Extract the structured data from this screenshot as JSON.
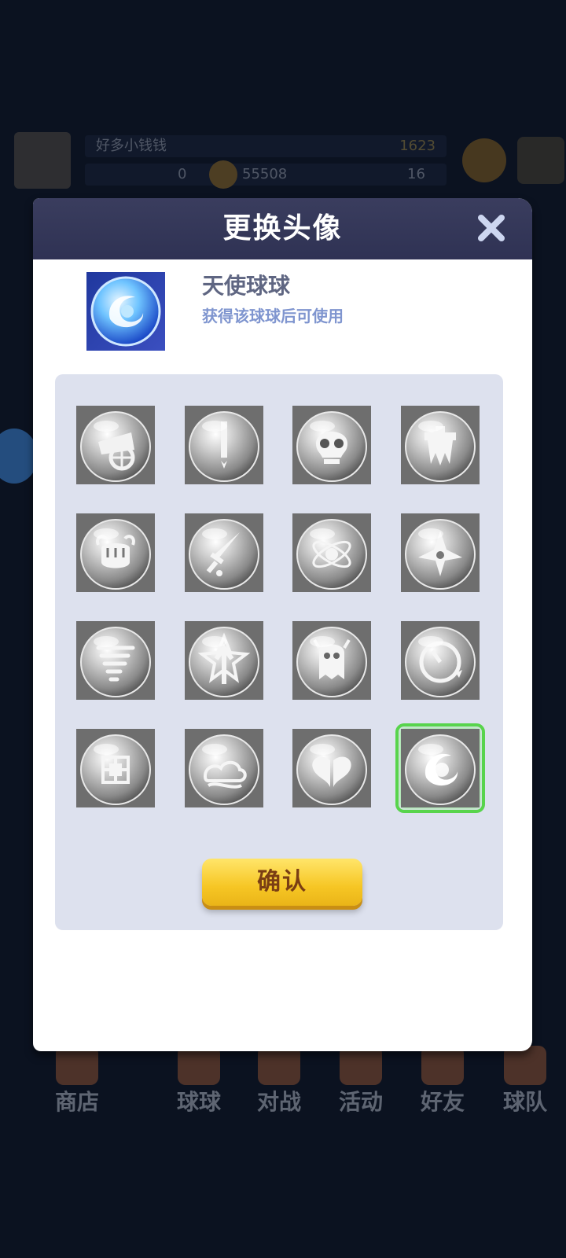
{
  "background": {
    "player_name": "好多小钱钱",
    "trophies": "1623",
    "stat_a": "0",
    "gold": "55508",
    "stat_b": "16"
  },
  "bottom_nav": [
    {
      "label": "商店"
    },
    {
      "label": "球球"
    },
    {
      "label": "对战"
    },
    {
      "label": "活动"
    },
    {
      "label": "好友"
    },
    {
      "label": "球队"
    }
  ],
  "modal": {
    "title": "更换头像",
    "selected_name": "天使球球",
    "selected_hint": "获得该球球后可使用",
    "confirm_label": "确认",
    "avatars": [
      {
        "icon": "cannon-ball-icon"
      },
      {
        "icon": "sword-ball-icon"
      },
      {
        "icon": "skull-ball-icon"
      },
      {
        "icon": "castle-ball-icon"
      },
      {
        "icon": "fist-ball-icon"
      },
      {
        "icon": "dagger-ball-icon"
      },
      {
        "icon": "atom-ball-icon"
      },
      {
        "icon": "shuriken-ball-icon"
      },
      {
        "icon": "tornado-ball-icon"
      },
      {
        "icon": "star-arrow-ball-icon"
      },
      {
        "icon": "ghost-ball-icon"
      },
      {
        "icon": "clock-ball-icon"
      },
      {
        "icon": "cube-ball-icon"
      },
      {
        "icon": "cloud-ball-icon"
      },
      {
        "icon": "wings-ball-icon"
      },
      {
        "icon": "angel-ball-icon",
        "selected": true
      }
    ]
  }
}
